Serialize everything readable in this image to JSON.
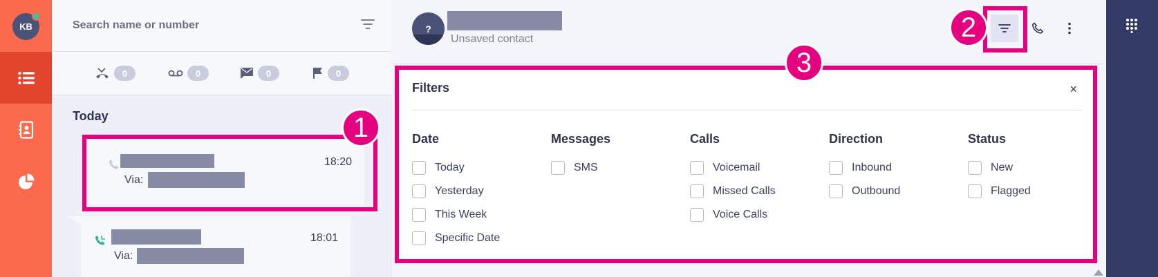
{
  "rail": {
    "avatar_initials": "KB"
  },
  "search": {
    "placeholder": "Search name or number"
  },
  "counters": [
    {
      "icon": "missed-call-icon",
      "count": "0"
    },
    {
      "icon": "voicemail-icon",
      "count": "0"
    },
    {
      "icon": "message-icon",
      "count": "0"
    },
    {
      "icon": "flag-icon",
      "count": "0"
    }
  ],
  "list": {
    "section_title": "Today",
    "items": [
      {
        "time": "18:20",
        "via_label": "Via:"
      },
      {
        "time": "18:01",
        "via_label": "Via:"
      }
    ]
  },
  "contact": {
    "avatar_label": "?",
    "subtitle": "Unsaved contact"
  },
  "filters": {
    "title": "Filters",
    "close_label": "×",
    "columns": [
      {
        "heading": "Date",
        "options": [
          "Today",
          "Yesterday",
          "This Week",
          "Specific Date"
        ]
      },
      {
        "heading": "Messages",
        "options": [
          "SMS"
        ]
      },
      {
        "heading": "Calls",
        "options": [
          "Voicemail",
          "Missed Calls",
          "Voice Calls"
        ]
      },
      {
        "heading": "Direction",
        "options": [
          "Inbound",
          "Outbound"
        ]
      },
      {
        "heading": "Status",
        "options": [
          "New",
          "Flagged"
        ]
      }
    ]
  },
  "annotations": [
    "1",
    "2",
    "3"
  ],
  "colors": {
    "accent": "#fb6a4d",
    "highlight": "#e4007f",
    "dark_rail": "#343b66"
  }
}
